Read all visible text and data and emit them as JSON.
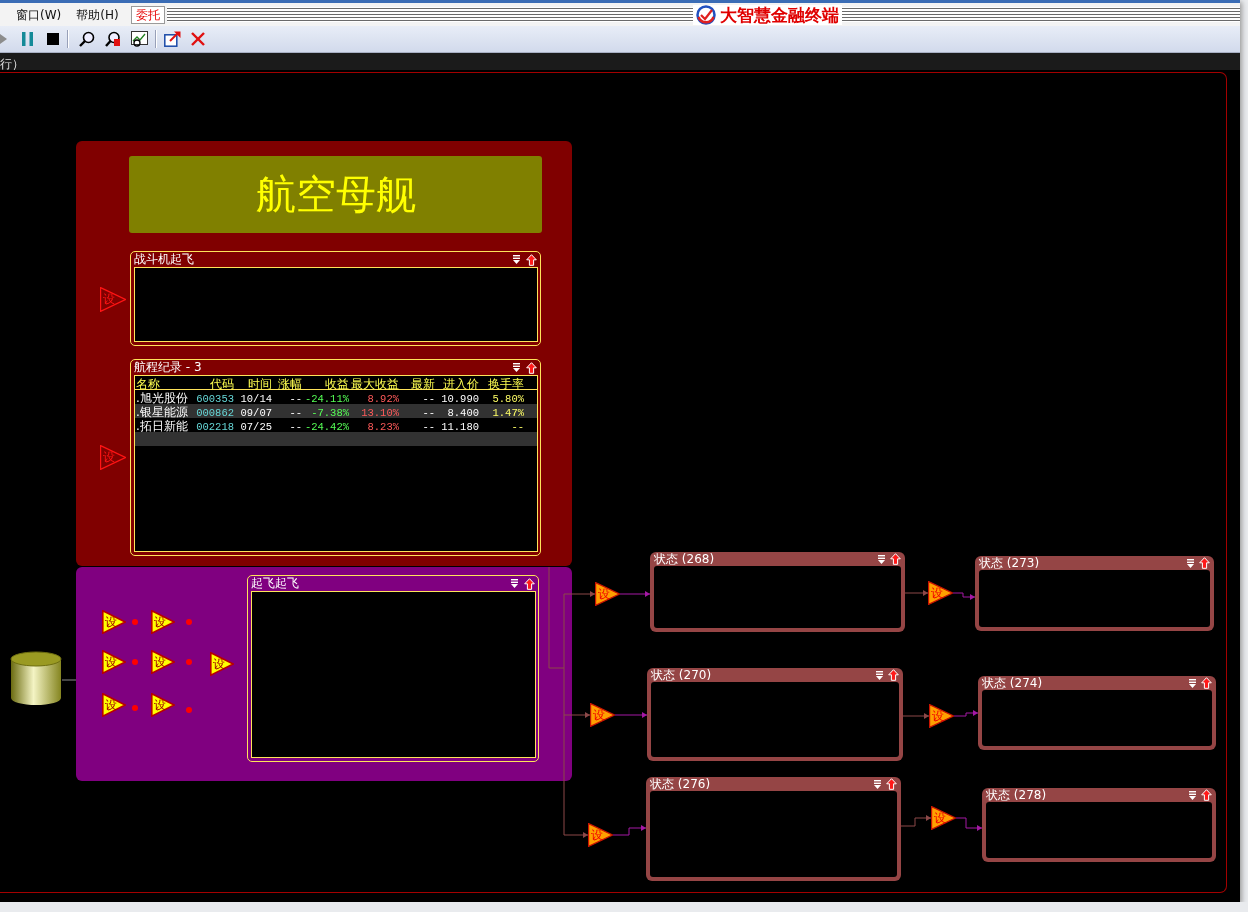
{
  "menu_bar": {
    "items": [
      {
        "label": "窗口(W)",
        "kind": "menu"
      },
      {
        "label": "帮助(H)",
        "kind": "menu"
      },
      {
        "label": "委托",
        "kind": "highlight"
      }
    ],
    "brand": "大智慧金融终端"
  },
  "status_bar": {
    "text": "行）"
  },
  "diagram": {
    "groups": [
      {
        "color": "#800000",
        "title": "航空母舰",
        "triggers": [
          {
            "label": "设",
            "kind": "hollow"
          },
          {
            "label": "设",
            "kind": "hollow"
          }
        ],
        "panels": [
          {
            "title": "战斗机起飞"
          },
          {
            "title": "航程纪录 - 3",
            "table": {
              "columns": [
                "名称",
                "代码",
                "时间",
                "涨幅",
                "收益",
                "最大收益",
                "最新",
                "进入价",
                "换手率"
              ],
              "rows": [
                [
                  ".旭光股份",
                  "600353",
                  "10/14",
                  "--",
                  "-24.11%",
                  "8.92%",
                  "--",
                  "10.990",
                  "5.80%"
                ],
                [
                  ".银星能源",
                  "000862",
                  "09/07",
                  "--",
                  "-7.38%",
                  "13.10%",
                  "--",
                  "8.400",
                  "1.47%"
                ],
                [
                  ".拓日新能",
                  "002218",
                  "07/25",
                  "--",
                  "-24.42%",
                  "8.23%",
                  "--",
                  "11.180",
                  "--"
                ]
              ]
            }
          }
        ]
      },
      {
        "color": "#800080",
        "triggers": [
          {
            "label": "设",
            "kind": "solid",
            "signal": true
          },
          {
            "label": "设",
            "kind": "solid",
            "signal": true
          },
          {
            "label": "设",
            "kind": "solid",
            "signal": true
          },
          {
            "label": "设",
            "kind": "solid",
            "signal": true
          },
          {
            "label": "设",
            "kind": "solid",
            "signal": false
          },
          {
            "label": "设",
            "kind": "solid",
            "signal": true
          },
          {
            "label": "设",
            "kind": "solid",
            "signal": true
          }
        ],
        "panels": [
          {
            "title": "起飞起飞"
          }
        ]
      }
    ],
    "flows": [
      {
        "stages": [
          {
            "trigger": {
              "label": "设",
              "kind": "orange"
            },
            "title": "状态 (268)"
          },
          {
            "trigger": {
              "label": "设",
              "kind": "orange"
            },
            "title": "状态 (273)"
          }
        ]
      },
      {
        "stages": [
          {
            "trigger": {
              "label": "设",
              "kind": "orange"
            },
            "title": "状态 (270)"
          },
          {
            "trigger": {
              "label": "设",
              "kind": "orange"
            },
            "title": "状态 (274)"
          }
        ]
      },
      {
        "stages": [
          {
            "trigger": {
              "label": "设",
              "kind": "orange"
            },
            "title": "状态 (276)"
          },
          {
            "trigger": {
              "label": "设",
              "kind": "orange"
            },
            "title": "状态 (278)"
          }
        ]
      }
    ]
  }
}
